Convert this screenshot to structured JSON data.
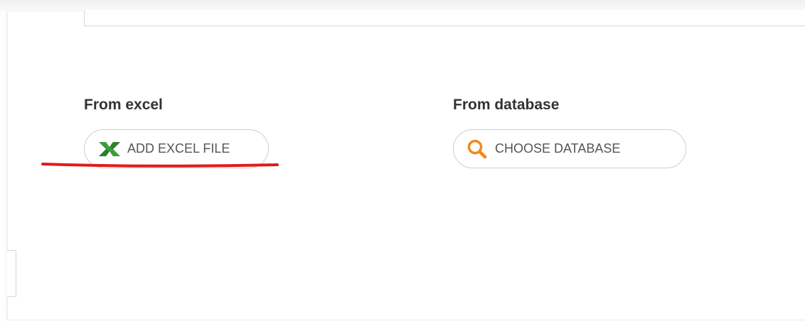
{
  "sections": {
    "excel": {
      "title": "From excel",
      "button_label": "ADD EXCEL FILE",
      "icon": "excel-x-icon"
    },
    "database": {
      "title": "From database",
      "button_label": "CHOOSE DATABASE",
      "icon": "search-icon"
    }
  },
  "colors": {
    "excel_icon": "#3a9d3a",
    "search_icon": "#f08a1c",
    "annotation_underline": "#e01b1b",
    "text": "#333333",
    "button_text": "#555555",
    "border": "#cfcfcf"
  }
}
